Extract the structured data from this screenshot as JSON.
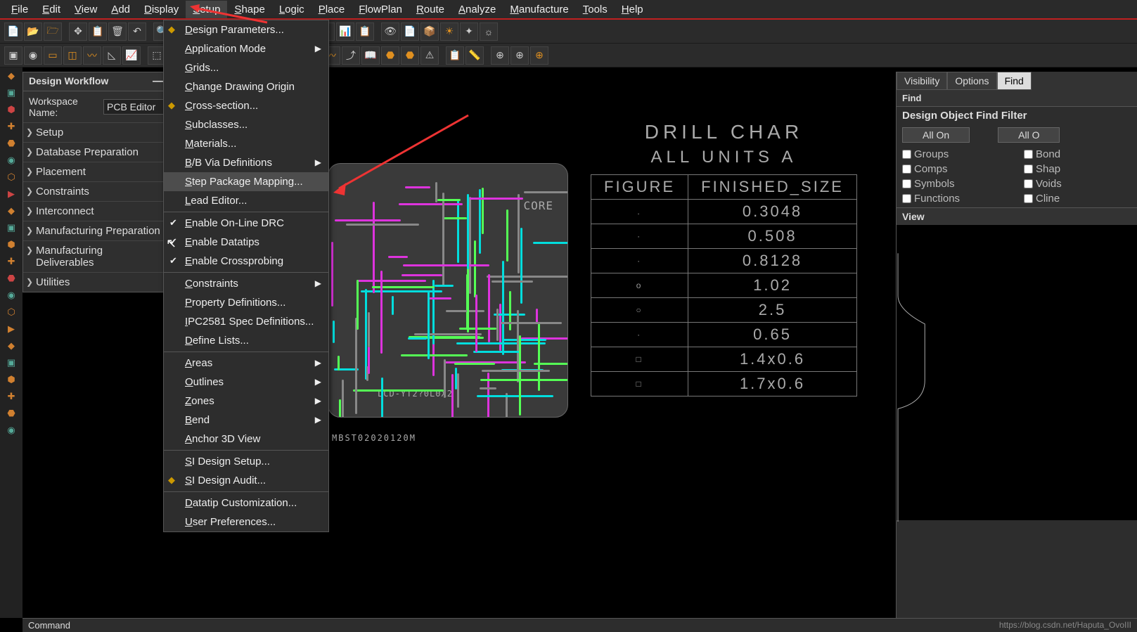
{
  "menubar": [
    "File",
    "Edit",
    "View",
    "Add",
    "Display",
    "Setup",
    "Shape",
    "Logic",
    "Place",
    "FlowPlan",
    "Route",
    "Analyze",
    "Manufacture",
    "Tools",
    "Help"
  ],
  "menubar_active": "Setup",
  "dropdown": {
    "items": [
      {
        "label": "Design Parameters...",
        "icon": "gear"
      },
      {
        "label": "Application Mode",
        "submenu": true
      },
      {
        "label": "Grids..."
      },
      {
        "label": "Change Drawing Origin"
      },
      {
        "label": "Cross-section...",
        "icon": "layers"
      },
      {
        "label": "Subclasses..."
      },
      {
        "label": "Materials..."
      },
      {
        "label": "B/B Via Definitions",
        "submenu": true
      },
      {
        "label": "Step Package Mapping...",
        "highlight": true
      },
      {
        "label": "Lead Editor..."
      },
      {
        "sep": true
      },
      {
        "label": "Enable On-Line DRC",
        "checked": true
      },
      {
        "label": "Enable Datatips",
        "checked": true
      },
      {
        "label": "Enable Crossprobing",
        "checked": true
      },
      {
        "sep": true
      },
      {
        "label": "Constraints",
        "submenu": true
      },
      {
        "label": "Property Definitions..."
      },
      {
        "label": "IPC2581 Spec Definitions..."
      },
      {
        "label": "Define Lists..."
      },
      {
        "sep": true
      },
      {
        "label": "Areas",
        "submenu": true
      },
      {
        "label": "Outlines",
        "submenu": true
      },
      {
        "label": "Zones",
        "submenu": true
      },
      {
        "label": "Bend",
        "submenu": true
      },
      {
        "label": "Anchor 3D View"
      },
      {
        "sep": true
      },
      {
        "label": "SI Design Setup..."
      },
      {
        "label": "SI Design Audit...",
        "icon": "audit"
      },
      {
        "sep": true
      },
      {
        "label": "Datatip Customization..."
      },
      {
        "label": "User Preferences..."
      }
    ]
  },
  "design_workflow": {
    "title": "Design Workflow",
    "ws_label": "Workspace Name:",
    "ws_value": "PCB Editor",
    "items": [
      "Setup",
      "Database Preparation",
      "Placement",
      "Constraints",
      "Interconnect",
      "Manufacturing Preparation",
      "Manufacturing Deliverables",
      "Utilities"
    ]
  },
  "pcb": {
    "core_label": "CORE",
    "lcd_label": "LCD-YT2?0L0X2",
    "bottom_label": "MBST02020120M"
  },
  "drill_chart": {
    "title": "DRILL CHAR",
    "subtitle": "ALL UNITS A",
    "headers": [
      "FIGURE",
      "FINISHED_SIZE"
    ],
    "rows": [
      {
        "fig": ".",
        "size": "0.3048"
      },
      {
        "fig": "·",
        "size": "0.508"
      },
      {
        "fig": "·",
        "size": "0.8128"
      },
      {
        "fig": "o",
        "size": "1.02"
      },
      {
        "fig": "○",
        "size": "2.5"
      },
      {
        "fig": "·",
        "size": "0.65"
      },
      {
        "fig": "□",
        "size": "1.4x0.6"
      },
      {
        "fig": "□",
        "size": "1.7x0.6"
      }
    ]
  },
  "right_panel": {
    "tabs": [
      "Visibility",
      "Options",
      "Find"
    ],
    "active_tab": "Find",
    "find_label": "Find",
    "filter_title": "Design Object Find Filter",
    "all_on": "All On",
    "all_off": "All O",
    "checks_left": [
      "Groups",
      "Comps",
      "Symbols",
      "Functions"
    ],
    "checks_right": [
      "Bond",
      "Shap",
      "Voids",
      "Cline"
    ],
    "view_label": "View"
  },
  "command_bar": {
    "label": "Command",
    "watermark": "https://blog.csdn.net/Haputa_OvoIII"
  }
}
